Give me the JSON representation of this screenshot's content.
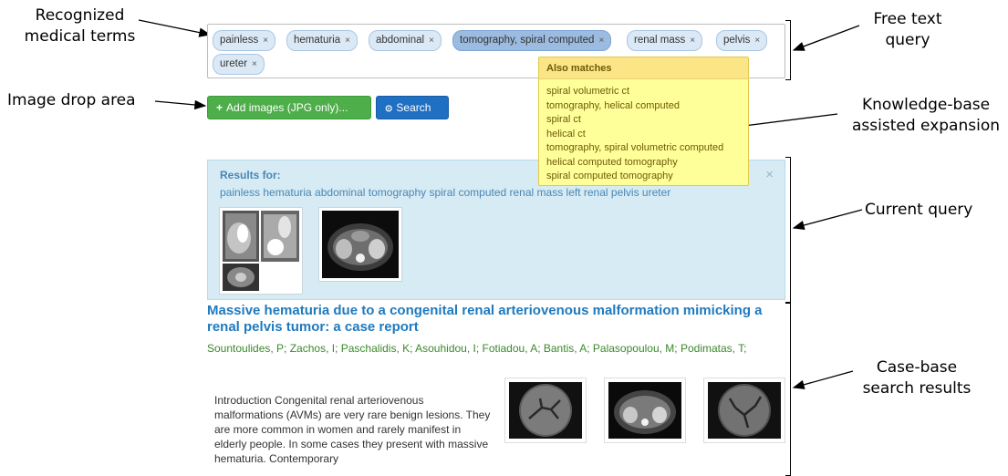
{
  "annotations": {
    "recognized_terms": [
      "Recognized",
      "medical terms"
    ],
    "free_text_query": [
      "Free text",
      "query"
    ],
    "image_drop_area": "Image drop area",
    "kb_expansion": [
      "Knowledge-base",
      "assisted expansion"
    ],
    "current_query": "Current query",
    "case_base_results": [
      "Case-base",
      "search results"
    ]
  },
  "query_tags": [
    {
      "label": "painless",
      "remove": "×"
    },
    {
      "label": "hematuria",
      "remove": "×"
    },
    {
      "label": "abdominal",
      "remove": "×"
    },
    {
      "label": "tomography, spiral computed",
      "remove": "×",
      "active": true
    },
    {
      "label": "renal mass",
      "remove": "×"
    },
    {
      "label": "pelvis",
      "remove": "×"
    },
    {
      "label": "ureter",
      "remove": "×"
    }
  ],
  "toolbar": {
    "add_images_icon": "+",
    "add_images_label": "Add images (JPG only)...",
    "search_icon": "⊙",
    "search_label": "Search"
  },
  "also_matches": {
    "header": "Also matches",
    "items": [
      "spiral volumetric ct",
      "tomography, helical computed",
      "spiral ct",
      "helical ct",
      "tomography, spiral volumetric computed",
      "helical computed tomography",
      "spiral computed tomography"
    ]
  },
  "results_for": {
    "title": "Results for:",
    "query": "painless hematuria abdominal tomography spiral computed renal mass left renal pelvis ureter",
    "close": "×"
  },
  "article": {
    "title": "Massive hematuria due to a congenital renal arteriovenous malformation mimicking a renal pelvis tumor: a case report",
    "authors": "Sountoulides, P;  Zachos, I;  Paschalidis, K;  Asouhidou, I;  Fotiadou, A;  Bantis, A;  Palasopoulou, M;  Podimatas, T;",
    "abstract": "Introduction Congenital renal arteriovenous malformations (AVMs) are very rare benign lesions. They are more common in women and rarely manifest in elderly people. In some cases they present with massive hematuria. Contemporary"
  },
  "colors": {
    "tag_bg": "#dbe9f6",
    "tag_active_bg": "#9bbbe0",
    "add_button": "#4eae4a",
    "search_button": "#1f6fc2",
    "popover_bg": "#ffff99",
    "results_panel_bg": "#d6ebf4",
    "title_blue": "#1f7abf",
    "author_green": "#3a8a2a"
  }
}
